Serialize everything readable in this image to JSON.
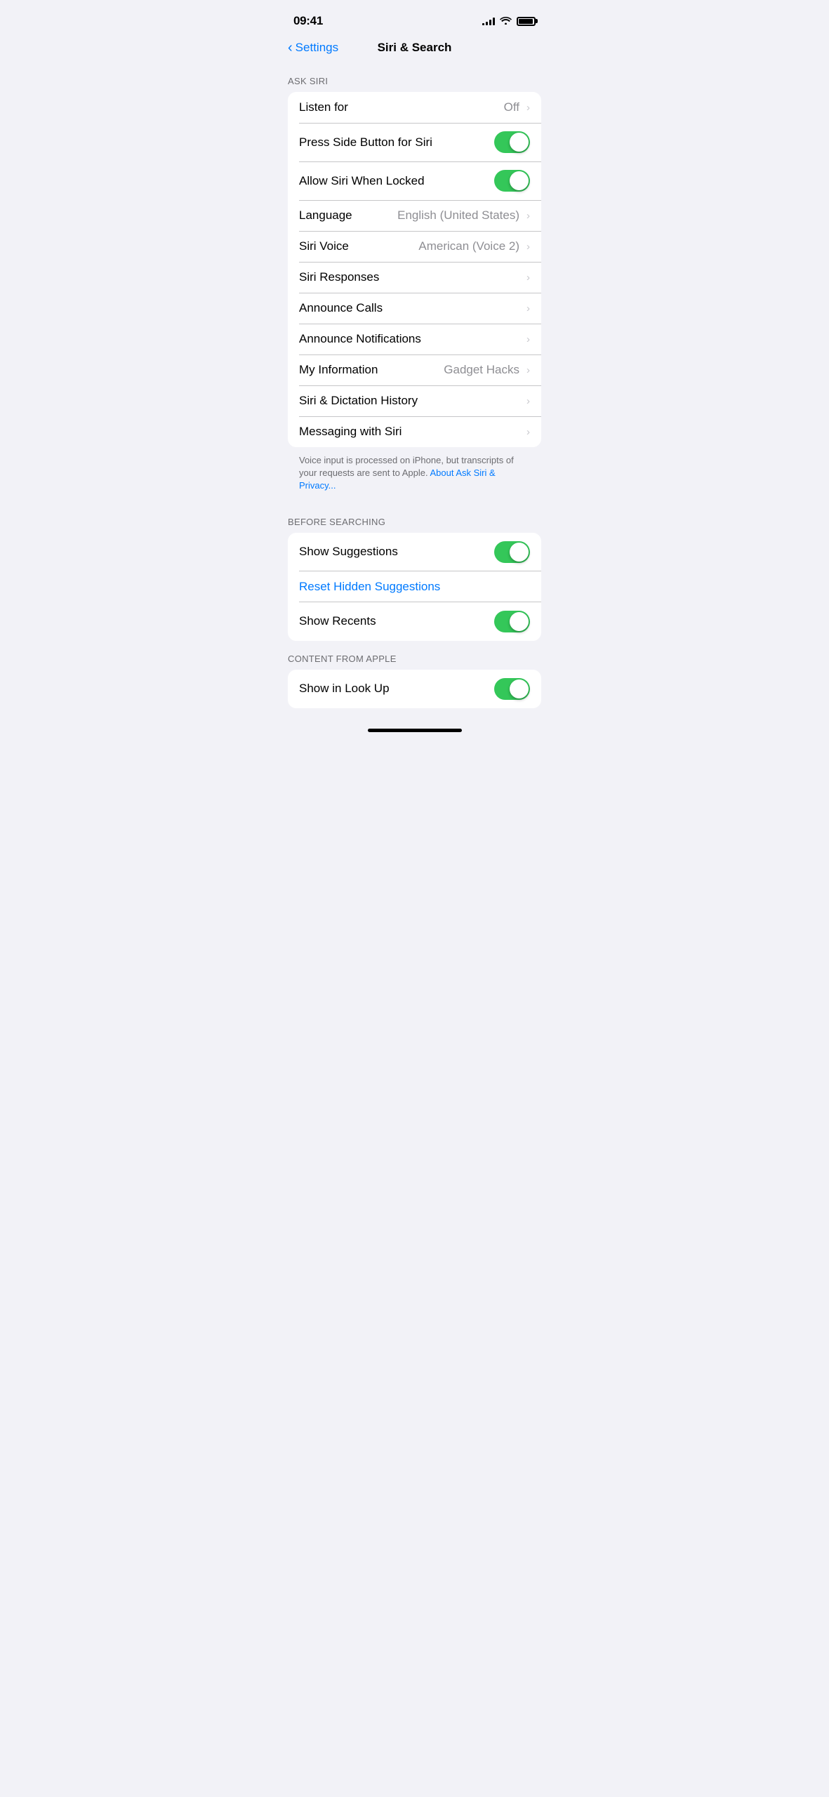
{
  "statusBar": {
    "time": "09:41",
    "signalBars": [
      4,
      6,
      8,
      10,
      12
    ],
    "batteryLevel": 100
  },
  "navigation": {
    "backLabel": "Settings",
    "title": "Siri & Search"
  },
  "sections": {
    "askSiri": {
      "header": "ASK SIRI",
      "rows": [
        {
          "id": "listen-for",
          "label": "Listen for",
          "value": "Off",
          "type": "chevron"
        },
        {
          "id": "press-side-button",
          "label": "Press Side Button for Siri",
          "value": "",
          "type": "toggle",
          "toggleOn": true
        },
        {
          "id": "allow-when-locked",
          "label": "Allow Siri When Locked",
          "value": "",
          "type": "toggle",
          "toggleOn": true
        },
        {
          "id": "language",
          "label": "Language",
          "value": "English (United States)",
          "type": "chevron"
        },
        {
          "id": "siri-voice",
          "label": "Siri Voice",
          "value": "American (Voice 2)",
          "type": "chevron"
        },
        {
          "id": "siri-responses",
          "label": "Siri Responses",
          "value": "",
          "type": "chevron"
        },
        {
          "id": "announce-calls",
          "label": "Announce Calls",
          "value": "",
          "type": "chevron"
        },
        {
          "id": "announce-notifications",
          "label": "Announce Notifications",
          "value": "",
          "type": "chevron"
        },
        {
          "id": "my-information",
          "label": "My Information",
          "value": "Gadget Hacks",
          "type": "chevron"
        },
        {
          "id": "siri-dictation-history",
          "label": "Siri & Dictation History",
          "value": "",
          "type": "chevron"
        },
        {
          "id": "messaging-with-siri",
          "label": "Messaging with Siri",
          "value": "",
          "type": "chevron"
        }
      ],
      "footer": "Voice input is processed on iPhone, but transcripts of your requests are sent to Apple.",
      "footerLink": "About Ask Siri & Privacy..."
    },
    "beforeSearching": {
      "header": "BEFORE SEARCHING",
      "rows": [
        {
          "id": "show-suggestions",
          "label": "Show Suggestions",
          "value": "",
          "type": "toggle",
          "toggleOn": true
        },
        {
          "id": "reset-hidden-suggestions",
          "label": "Reset Hidden Suggestions",
          "value": "",
          "type": "link"
        },
        {
          "id": "show-recents",
          "label": "Show Recents",
          "value": "",
          "type": "toggle",
          "toggleOn": true
        }
      ]
    },
    "contentFromApple": {
      "header": "CONTENT FROM APPLE",
      "rows": [
        {
          "id": "show-in-look-up",
          "label": "Show in Look Up",
          "value": "",
          "type": "toggle",
          "toggleOn": true
        }
      ]
    }
  }
}
